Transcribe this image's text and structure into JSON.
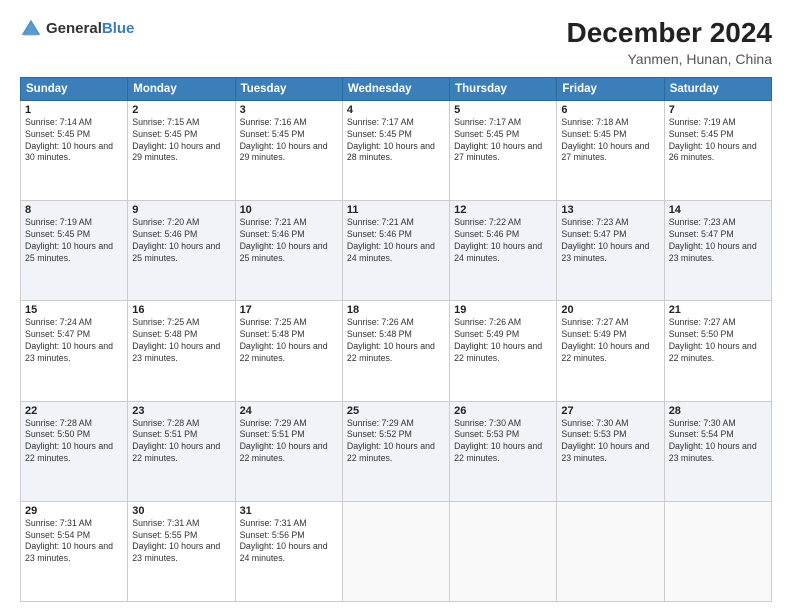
{
  "logo": {
    "general": "General",
    "blue": "Blue"
  },
  "header": {
    "month": "December 2024",
    "location": "Yanmen, Hunan, China"
  },
  "weekdays": [
    "Sunday",
    "Monday",
    "Tuesday",
    "Wednesday",
    "Thursday",
    "Friday",
    "Saturday"
  ],
  "weeks": [
    [
      {
        "day": "1",
        "sunrise": "7:14 AM",
        "sunset": "5:45 PM",
        "daylight": "10 hours and 30 minutes."
      },
      {
        "day": "2",
        "sunrise": "7:15 AM",
        "sunset": "5:45 PM",
        "daylight": "10 hours and 29 minutes."
      },
      {
        "day": "3",
        "sunrise": "7:16 AM",
        "sunset": "5:45 PM",
        "daylight": "10 hours and 29 minutes."
      },
      {
        "day": "4",
        "sunrise": "7:17 AM",
        "sunset": "5:45 PM",
        "daylight": "10 hours and 28 minutes."
      },
      {
        "day": "5",
        "sunrise": "7:17 AM",
        "sunset": "5:45 PM",
        "daylight": "10 hours and 27 minutes."
      },
      {
        "day": "6",
        "sunrise": "7:18 AM",
        "sunset": "5:45 PM",
        "daylight": "10 hours and 27 minutes."
      },
      {
        "day": "7",
        "sunrise": "7:19 AM",
        "sunset": "5:45 PM",
        "daylight": "10 hours and 26 minutes."
      }
    ],
    [
      {
        "day": "8",
        "sunrise": "7:19 AM",
        "sunset": "5:45 PM",
        "daylight": "10 hours and 25 minutes."
      },
      {
        "day": "9",
        "sunrise": "7:20 AM",
        "sunset": "5:46 PM",
        "daylight": "10 hours and 25 minutes."
      },
      {
        "day": "10",
        "sunrise": "7:21 AM",
        "sunset": "5:46 PM",
        "daylight": "10 hours and 25 minutes."
      },
      {
        "day": "11",
        "sunrise": "7:21 AM",
        "sunset": "5:46 PM",
        "daylight": "10 hours and 24 minutes."
      },
      {
        "day": "12",
        "sunrise": "7:22 AM",
        "sunset": "5:46 PM",
        "daylight": "10 hours and 24 minutes."
      },
      {
        "day": "13",
        "sunrise": "7:23 AM",
        "sunset": "5:47 PM",
        "daylight": "10 hours and 23 minutes."
      },
      {
        "day": "14",
        "sunrise": "7:23 AM",
        "sunset": "5:47 PM",
        "daylight": "10 hours and 23 minutes."
      }
    ],
    [
      {
        "day": "15",
        "sunrise": "7:24 AM",
        "sunset": "5:47 PM",
        "daylight": "10 hours and 23 minutes."
      },
      {
        "day": "16",
        "sunrise": "7:25 AM",
        "sunset": "5:48 PM",
        "daylight": "10 hours and 23 minutes."
      },
      {
        "day": "17",
        "sunrise": "7:25 AM",
        "sunset": "5:48 PM",
        "daylight": "10 hours and 22 minutes."
      },
      {
        "day": "18",
        "sunrise": "7:26 AM",
        "sunset": "5:48 PM",
        "daylight": "10 hours and 22 minutes."
      },
      {
        "day": "19",
        "sunrise": "7:26 AM",
        "sunset": "5:49 PM",
        "daylight": "10 hours and 22 minutes."
      },
      {
        "day": "20",
        "sunrise": "7:27 AM",
        "sunset": "5:49 PM",
        "daylight": "10 hours and 22 minutes."
      },
      {
        "day": "21",
        "sunrise": "7:27 AM",
        "sunset": "5:50 PM",
        "daylight": "10 hours and 22 minutes."
      }
    ],
    [
      {
        "day": "22",
        "sunrise": "7:28 AM",
        "sunset": "5:50 PM",
        "daylight": "10 hours and 22 minutes."
      },
      {
        "day": "23",
        "sunrise": "7:28 AM",
        "sunset": "5:51 PM",
        "daylight": "10 hours and 22 minutes."
      },
      {
        "day": "24",
        "sunrise": "7:29 AM",
        "sunset": "5:51 PM",
        "daylight": "10 hours and 22 minutes."
      },
      {
        "day": "25",
        "sunrise": "7:29 AM",
        "sunset": "5:52 PM",
        "daylight": "10 hours and 22 minutes."
      },
      {
        "day": "26",
        "sunrise": "7:30 AM",
        "sunset": "5:53 PM",
        "daylight": "10 hours and 22 minutes."
      },
      {
        "day": "27",
        "sunrise": "7:30 AM",
        "sunset": "5:53 PM",
        "daylight": "10 hours and 23 minutes."
      },
      {
        "day": "28",
        "sunrise": "7:30 AM",
        "sunset": "5:54 PM",
        "daylight": "10 hours and 23 minutes."
      }
    ],
    [
      {
        "day": "29",
        "sunrise": "7:31 AM",
        "sunset": "5:54 PM",
        "daylight": "10 hours and 23 minutes."
      },
      {
        "day": "30",
        "sunrise": "7:31 AM",
        "sunset": "5:55 PM",
        "daylight": "10 hours and 23 minutes."
      },
      {
        "day": "31",
        "sunrise": "7:31 AM",
        "sunset": "5:56 PM",
        "daylight": "10 hours and 24 minutes."
      },
      null,
      null,
      null,
      null
    ]
  ]
}
